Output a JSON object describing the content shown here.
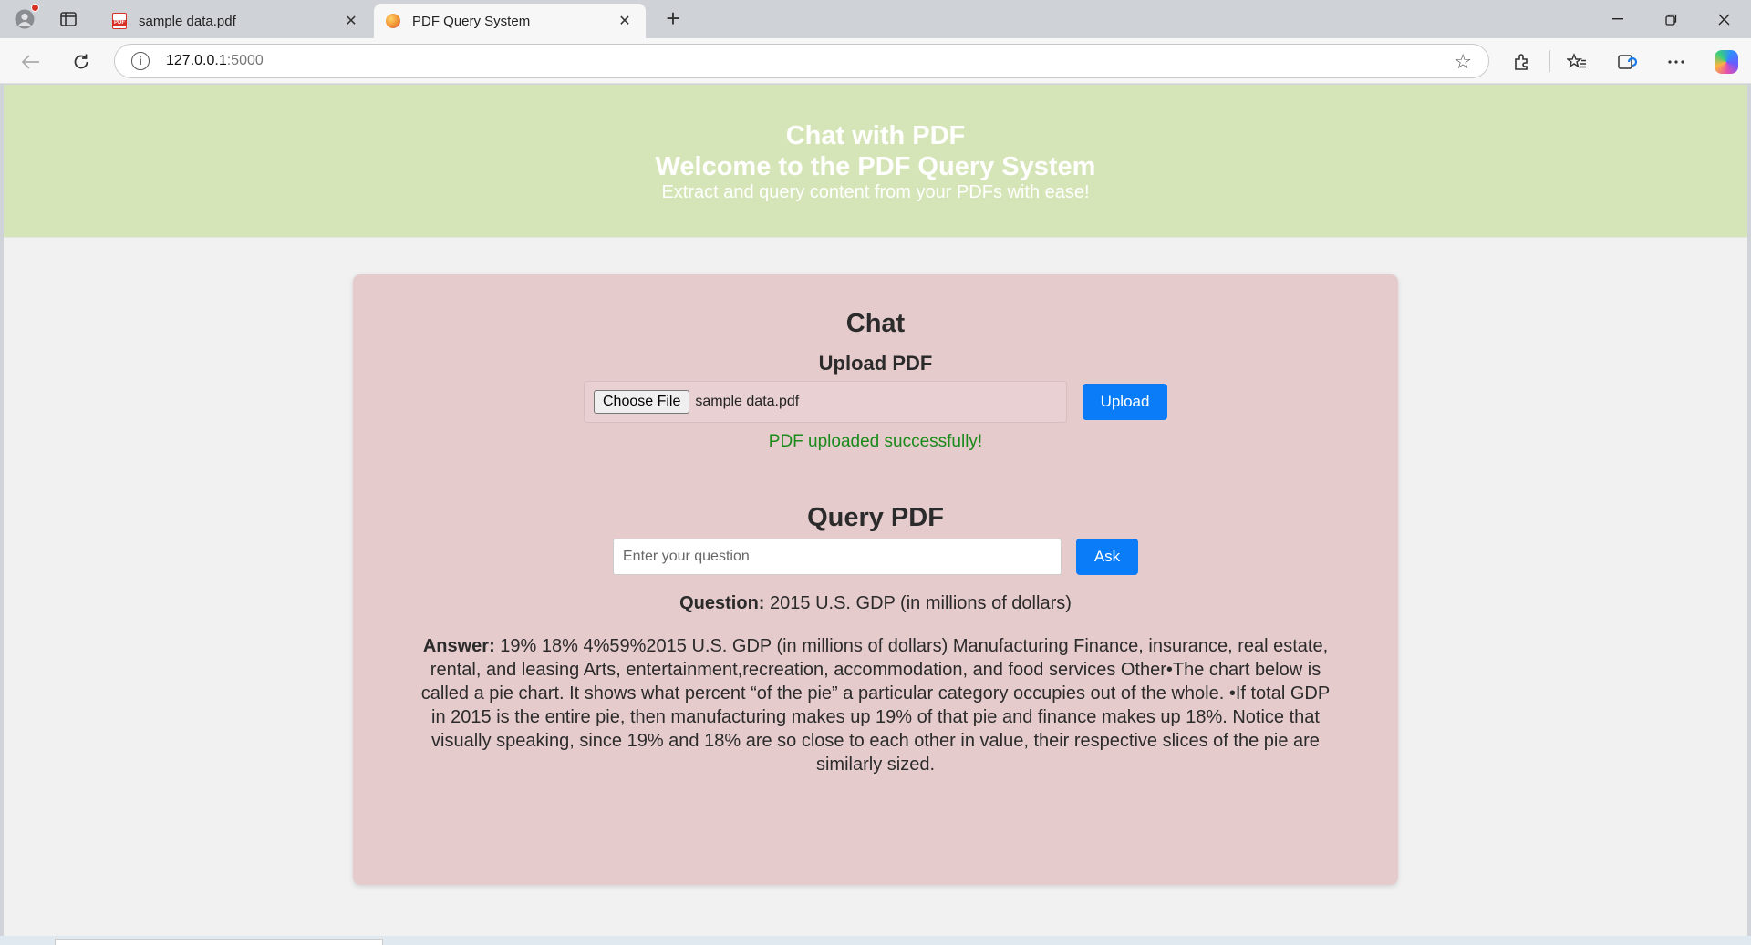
{
  "browser": {
    "tabs": [
      {
        "title": "sample data.pdf",
        "favicon": "pdf-icon",
        "active": false
      },
      {
        "title": "PDF Query System",
        "favicon": "app-orb-icon",
        "active": true
      }
    ],
    "address": {
      "host": "127.0.0.1",
      "port": ":5000"
    }
  },
  "header": {
    "title": "Chat with PDF",
    "welcome": "Welcome to the PDF Query System",
    "subtitle": "Extract and query content from your PDFs with ease!"
  },
  "chat": {
    "heading": "Chat",
    "upload": {
      "heading": "Upload PDF",
      "choose_label": "Choose File",
      "file_name": "sample data.pdf",
      "button_label": "Upload",
      "status": "PDF uploaded successfully!"
    },
    "query": {
      "heading": "Query PDF",
      "placeholder": "Enter your question",
      "button_label": "Ask",
      "question_label": "Question:",
      "question_text": "2015 U.S. GDP (in millions of dollars)",
      "answer_label": "Answer:",
      "answer_text": "19% 18% 4%59%2015 U.S. GDP (in millions of dollars) Manufacturing Finance, insurance, real estate, rental, and leasing Arts, entertainment,recreation, accommodation, and food services Other•The chart below is called a pie chart. It shows what percent “of the pie” a particular category occupies out of the whole. •If total GDP in 2015 is the entire pie, then manufacturing makes up 19% of that pie and finance makes up 18%. Notice that visually speaking, since 19% and 18% are so close to each other in value, their respective slices of the pie are similarly sized."
    }
  },
  "colors": {
    "hero_bg": "#d6e5b7",
    "card_bg": "#e6cbcd",
    "accent_button": "#0a7cf7",
    "success_text": "#1a8a1a"
  }
}
